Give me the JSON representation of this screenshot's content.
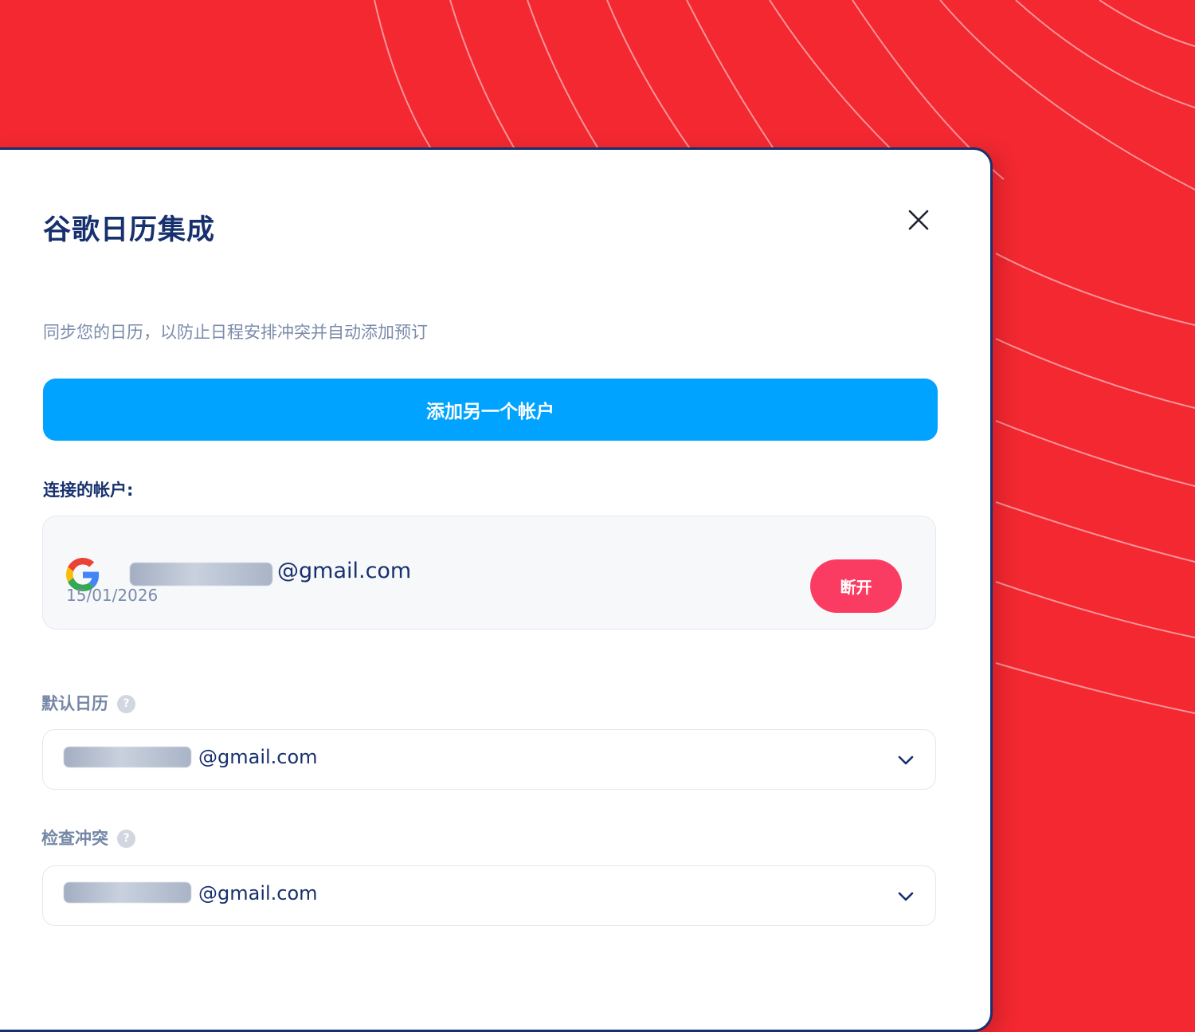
{
  "modal": {
    "title": "谷歌日历集成",
    "subtitle": "同步您的日历，以防止日程安排冲突并自动添加预订",
    "add_account_label": "添加另一个帐户"
  },
  "connected": {
    "label": "连接的帐户:",
    "account": {
      "provider_icon": "google-logo",
      "email_domain": "@gmail.com",
      "date": "15/01/2026",
      "disconnect_label": "断开"
    }
  },
  "default_calendar": {
    "label": "默认日历",
    "help": "?",
    "value_domain": "@gmail.com"
  },
  "check_conflicts": {
    "label": "检查冲突",
    "help": "?",
    "value_domain": "@gmail.com"
  },
  "colors": {
    "background": "#f32831",
    "primary_button": "#00a3ff",
    "danger_button": "#fa3c62",
    "title_text": "#17306e",
    "muted_text": "#7b8bab"
  }
}
